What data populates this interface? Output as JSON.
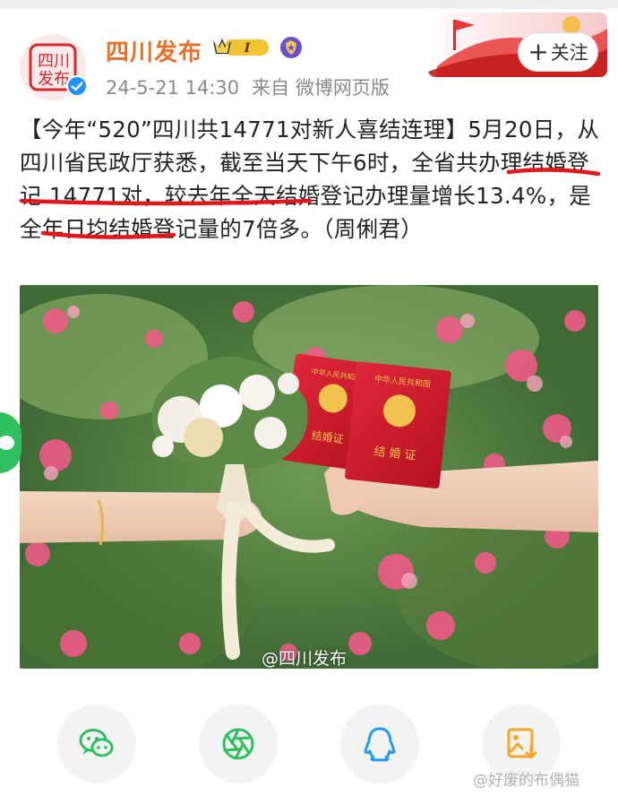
{
  "account": {
    "name": "四川发布",
    "vip_badge": "I",
    "verified_icon": "verified-icon",
    "badge_icon": "shield-badge-icon"
  },
  "meta": {
    "timestamp": "24-5-21 14:30",
    "source": "来自 微博网页版"
  },
  "follow_button": {
    "label": "关注",
    "icon": "+"
  },
  "post": {
    "title": "【今年“520”四川共14771对新人喜结连理】",
    "body_1": "5月20日，从四川省民政厅获悉，截至当天下午6时，",
    "body_2": "全省共办理结婚登记 14771对",
    "body_3": "，较去年全天结婚登记办理量",
    "body_4": "增长13.4%",
    "body_5": "，是全年日均结婚登记量的7倍多。（周俐君）"
  },
  "photo": {
    "watermark": "@四川发布",
    "book_title": "中华人民共和国",
    "book_label_1": "结婚证",
    "book_label_2": "结 婚 证"
  },
  "share": {
    "items": [
      {
        "name": "wechat-icon"
      },
      {
        "name": "moments-icon"
      },
      {
        "name": "qq-icon"
      },
      {
        "name": "save-image-icon"
      }
    ]
  },
  "bottom_watermark": "@好废的布偶猫",
  "colors": {
    "name_orange": "#e8702a",
    "underline_red": "#e3161c",
    "share_green": "#2fbf5f",
    "qq_blue": "#1f9cf0",
    "save_orange": "#f5a623"
  }
}
